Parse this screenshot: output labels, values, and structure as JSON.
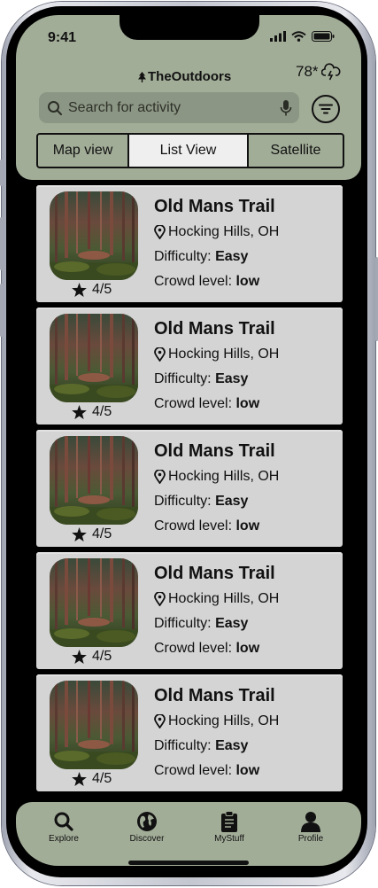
{
  "status_bar": {
    "time": "9:41"
  },
  "app": {
    "brand": "TheOutdoors"
  },
  "weather": {
    "temperature": "78*",
    "icon": "cloud-lightning-icon"
  },
  "search": {
    "placeholder": "Search for activity",
    "value": ""
  },
  "view_tabs": [
    {
      "label": "Map view",
      "active": false
    },
    {
      "label": "List View",
      "active": true
    },
    {
      "label": "Satellite",
      "active": false
    }
  ],
  "labels": {
    "difficulty": "Difficulty:",
    "crowd": "Crowd level:"
  },
  "trails": [
    {
      "name": "Old Mans Trail",
      "location": "Hocking Hills, OH",
      "difficulty": "Easy",
      "crowd": "low",
      "rating": "4/5"
    },
    {
      "name": "Old Mans Trail",
      "location": "Hocking Hills, OH",
      "difficulty": "Easy",
      "crowd": "low",
      "rating": "4/5"
    },
    {
      "name": "Old Mans Trail",
      "location": "Hocking Hills, OH",
      "difficulty": "Easy",
      "crowd": "low",
      "rating": "4/5"
    },
    {
      "name": "Old Mans Trail",
      "location": "Hocking Hills, OH",
      "difficulty": "Easy",
      "crowd": "low",
      "rating": "4/5"
    },
    {
      "name": "Old Mans Trail",
      "location": "Hocking Hills, OH",
      "difficulty": "Easy",
      "crowd": "low",
      "rating": "4/5"
    }
  ],
  "bottom_nav": [
    {
      "label": "Explore",
      "icon": "search-icon"
    },
    {
      "label": "Discover",
      "icon": "globe-icon"
    },
    {
      "label": "MyStuff",
      "icon": "clipboard-icon"
    },
    {
      "label": "Profile",
      "icon": "person-icon"
    }
  ],
  "colors": {
    "accent": "#a2ad98",
    "card": "#d4d4d4",
    "search_bg": "#8c9684"
  }
}
